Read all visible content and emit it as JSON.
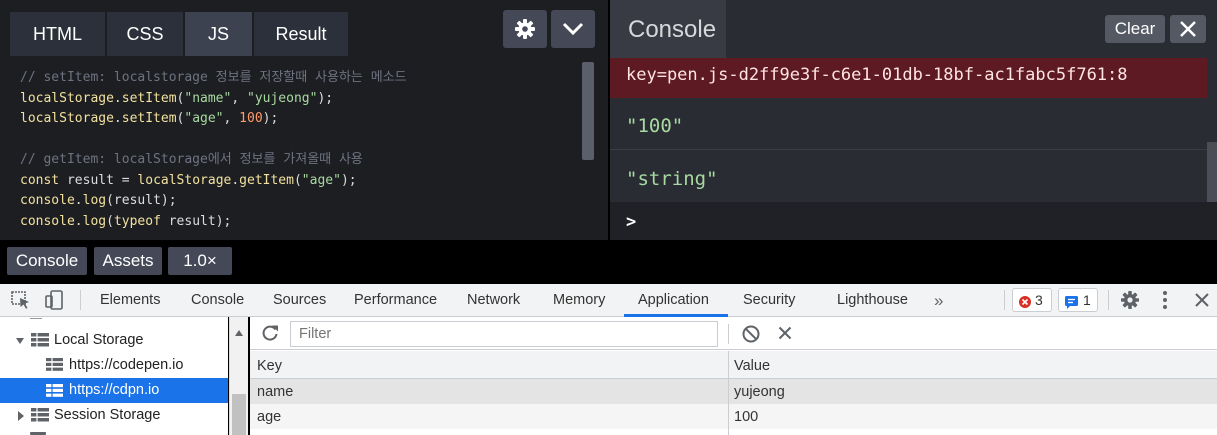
{
  "editor": {
    "tabs": [
      "HTML",
      "CSS",
      "JS",
      "Result"
    ],
    "code_lines": [
      {
        "parts": [
          {
            "t": "// setItem: localstorage 정보를 저장할때 사용하는 메소드",
            "c": "comment"
          }
        ]
      },
      {
        "parts": [
          {
            "t": "localStorage",
            "c": "fn"
          },
          {
            "t": ".",
            "c": ""
          },
          {
            "t": "setItem",
            "c": "fn"
          },
          {
            "t": "(",
            "c": ""
          },
          {
            "t": "\"name\"",
            "c": "str"
          },
          {
            "t": ", ",
            "c": ""
          },
          {
            "t": "\"yujeong\"",
            "c": "str"
          },
          {
            "t": ");",
            "c": ""
          }
        ]
      },
      {
        "parts": [
          {
            "t": "localStorage",
            "c": "fn"
          },
          {
            "t": ".",
            "c": ""
          },
          {
            "t": "setItem",
            "c": "fn"
          },
          {
            "t": "(",
            "c": ""
          },
          {
            "t": "\"age\"",
            "c": "str"
          },
          {
            "t": ", ",
            "c": ""
          },
          {
            "t": "100",
            "c": "num"
          },
          {
            "t": ");",
            "c": ""
          }
        ]
      },
      {
        "parts": []
      },
      {
        "parts": [
          {
            "t": "// getItem: localStorage에서 정보를 가져올때 사용",
            "c": "comment"
          }
        ]
      },
      {
        "parts": [
          {
            "t": "const",
            "c": "kw"
          },
          {
            "t": " result = ",
            "c": ""
          },
          {
            "t": "localStorage",
            "c": "fn"
          },
          {
            "t": ".",
            "c": ""
          },
          {
            "t": "getItem",
            "c": "fn"
          },
          {
            "t": "(",
            "c": ""
          },
          {
            "t": "\"age\"",
            "c": "str"
          },
          {
            "t": ");",
            "c": ""
          }
        ]
      },
      {
        "parts": [
          {
            "t": "console",
            "c": "fn"
          },
          {
            "t": ".",
            "c": ""
          },
          {
            "t": "log",
            "c": "fn"
          },
          {
            "t": "(result);",
            "c": ""
          }
        ]
      },
      {
        "parts": [
          {
            "t": "console",
            "c": "fn"
          },
          {
            "t": ".",
            "c": ""
          },
          {
            "t": "log",
            "c": "fn"
          },
          {
            "t": "(",
            "c": ""
          },
          {
            "t": "typeof",
            "c": "kw"
          },
          {
            "t": " result);",
            "c": ""
          }
        ]
      }
    ]
  },
  "console": {
    "title": "Console",
    "clear_label": "Clear",
    "error_line": "key=pen.js-d2ff9e3f-c6e1-01db-18bf-ac1fabc5f761:8",
    "log_1": "\"100\"",
    "log_2": "\"string\"",
    "prompt": ">"
  },
  "footer": {
    "console_label": "Console",
    "assets_label": "Assets",
    "zoom_label": "1.0×"
  },
  "devtools": {
    "tabs": [
      "Elements",
      "Console",
      "Sources",
      "Performance",
      "Network",
      "Memory",
      "Application",
      "Security",
      "Lighthouse"
    ],
    "active_tab": "Application",
    "more_tabs": "»",
    "error_count": "3",
    "message_count": "1",
    "sidebar": {
      "local_storage": "Local Storage",
      "origins": [
        "https://codepen.io",
        "https://cdpn.io"
      ],
      "selected_origin": "https://cdpn.io",
      "session_storage": "Session Storage"
    },
    "filter_placeholder": "Filter",
    "table": {
      "headers": [
        "Key",
        "Value"
      ],
      "rows": [
        {
          "key": "name",
          "value": "yujeong"
        },
        {
          "key": "age",
          "value": "100"
        }
      ]
    }
  },
  "colors": {
    "accent": "#1a73e8",
    "console_error_bg": "#5e1a22",
    "string_green": "#a8d9a1"
  }
}
